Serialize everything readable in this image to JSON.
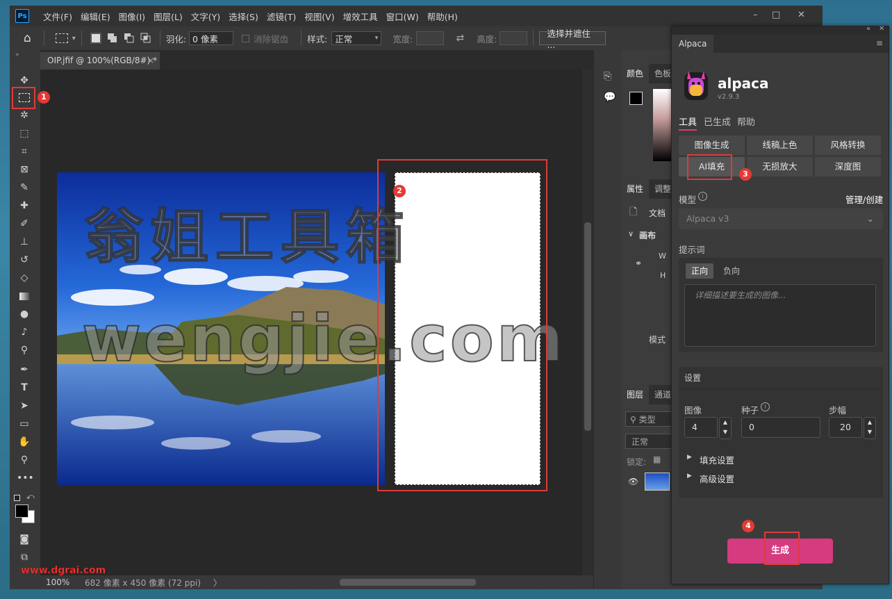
{
  "app": {
    "logo": "Ps"
  },
  "menu": [
    "文件(F)",
    "编辑(E)",
    "图像(I)",
    "图层(L)",
    "文字(Y)",
    "选择(S)",
    "滤镜(T)",
    "视图(V)",
    "增效工具",
    "窗口(W)",
    "帮助(H)"
  ],
  "window_controls": {
    "minimize": "–",
    "maximize": "□",
    "close": "✕"
  },
  "options": {
    "feather_label": "羽化:",
    "feather_value": "0 像素",
    "antialias": "消除锯齿",
    "style_label": "样式:",
    "style_value": "正常",
    "width_label": "宽度:",
    "height_label": "高度:",
    "select_mask": "选择并遮住 ..."
  },
  "document": {
    "tab_title": "OIP.jfif @ 100%(RGB/8#) *",
    "tab_close": "×"
  },
  "status": {
    "zoom": "100%",
    "size": "682 像素 x 450 像素 (72 ppi)",
    "arrow": "〉"
  },
  "panels": {
    "color_tabs": [
      "颜色",
      "色板"
    ],
    "props_tabs": [
      "属性",
      "调整"
    ],
    "doc_label": "文档",
    "canvas_section": "画布",
    "w_label": "W",
    "h_label": "H",
    "mode_fragment": "模式",
    "layers_tabs": [
      "图层",
      "通道"
    ],
    "search_placeholder": "类型",
    "blend_mode": "正常",
    "lock_label": "锁定:"
  },
  "alpaca": {
    "panel_title": "Alpaca",
    "name": "alpaca",
    "version": "v2.9.3",
    "tabs": [
      "工具",
      "已生成",
      "帮助"
    ],
    "tools": [
      "图像生成",
      "线稿上色",
      "风格转换",
      "AI填充",
      "无损放大",
      "深度图"
    ],
    "model_label": "模型",
    "manage": "管理/创建",
    "model_value": "Alpaca v3",
    "prompt_label": "提示词",
    "prompt_tabs": [
      "正向",
      "负向"
    ],
    "prompt_placeholder": "详细描述要生成的图像...",
    "settings_title": "设置",
    "image_label": "图像",
    "image_value": "4",
    "seed_label": "种子",
    "seed_value": "0",
    "steps_label": "步幅",
    "steps_value": "20",
    "fill_settings": "填充设置",
    "advanced_settings": "高级设置",
    "generate": "生成"
  },
  "annotations": [
    "1",
    "2",
    "3",
    "4"
  ],
  "watermark": {
    "line1": "翁姐工具箱",
    "line2": "wengjie.com",
    "footer": "www.dgrai.com"
  },
  "colors": {
    "accent": "#d63a7f",
    "marker": "#e53935",
    "ps_blue": "#31a8ff"
  }
}
